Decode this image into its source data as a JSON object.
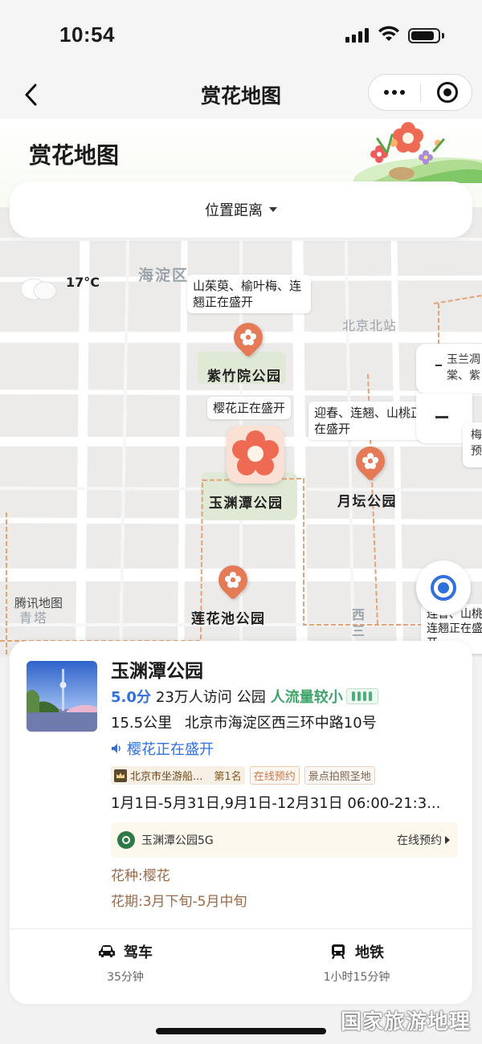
{
  "status_bar": {
    "time": "10:54"
  },
  "nav": {
    "title": "赏花地图"
  },
  "header": {
    "heading": "赏花地图"
  },
  "filter": {
    "label": "位置距离"
  },
  "weather": {
    "temp": "17°C",
    "icon": "cloud-icon"
  },
  "map": {
    "district_labels": [
      "海淀区"
    ],
    "station_label": "北京北站",
    "road_label_1": "西",
    "road_label_2": "三",
    "area_label": "青塔",
    "attribution": "腾讯地图",
    "callouts": [
      "山茱萸、榆叶梅、连翘正在盛开",
      "樱花正在盛开",
      "迎春、连翘、山桃正在盛开"
    ],
    "callout_lines": {
      "c1_l1": "山茱萸、榆叶梅、连",
      "c1_l2": "翘正在盛开",
      "c2_l1": "樱花正在盛开",
      "c3_l1": "迎春、连翘、山桃正",
      "c3_l2": "在盛开",
      "c4_l1": "连翘正在盛开",
      "c4_l0": "连香、山桃"
    },
    "parks": [
      "紫竹院公园",
      "玉渊潭公园",
      "月坛公园",
      "莲花池公园"
    ],
    "side_tabs": {
      "t1_l1": "玉兰凋",
      "t1_l2": "棠、紫",
      "t2_l1": "梅",
      "t2_l2": "预"
    }
  },
  "detail": {
    "name": "玉渊潭公园",
    "rating": "5.0分",
    "visits": "23万人访问",
    "type": "公园",
    "crowd": "人流量较小",
    "distance": "15.5公里",
    "address": "北京市海淀区西三环中路10号",
    "bloom": "樱花正在盛开",
    "rank_tag": "北京市坐游船...",
    "rank_num": "第1名",
    "tags": [
      "在线预约",
      "景点拍照圣地"
    ],
    "hours": "1月1日-5月31日,9月1日-12月31日 06:00-21:3...",
    "wifi_name": "玉渊潭公园5G",
    "wifi_action": "在线预约",
    "flower_type": "花种:樱花",
    "flower_period": "花期:3月下旬-5月中旬"
  },
  "routes": [
    {
      "mode": "驾车",
      "time": "35分钟",
      "icon": "car-icon"
    },
    {
      "mode": "地铁",
      "time": "1小时15分钟",
      "icon": "subway-icon"
    }
  ],
  "watermark": "国家旅游地理"
}
